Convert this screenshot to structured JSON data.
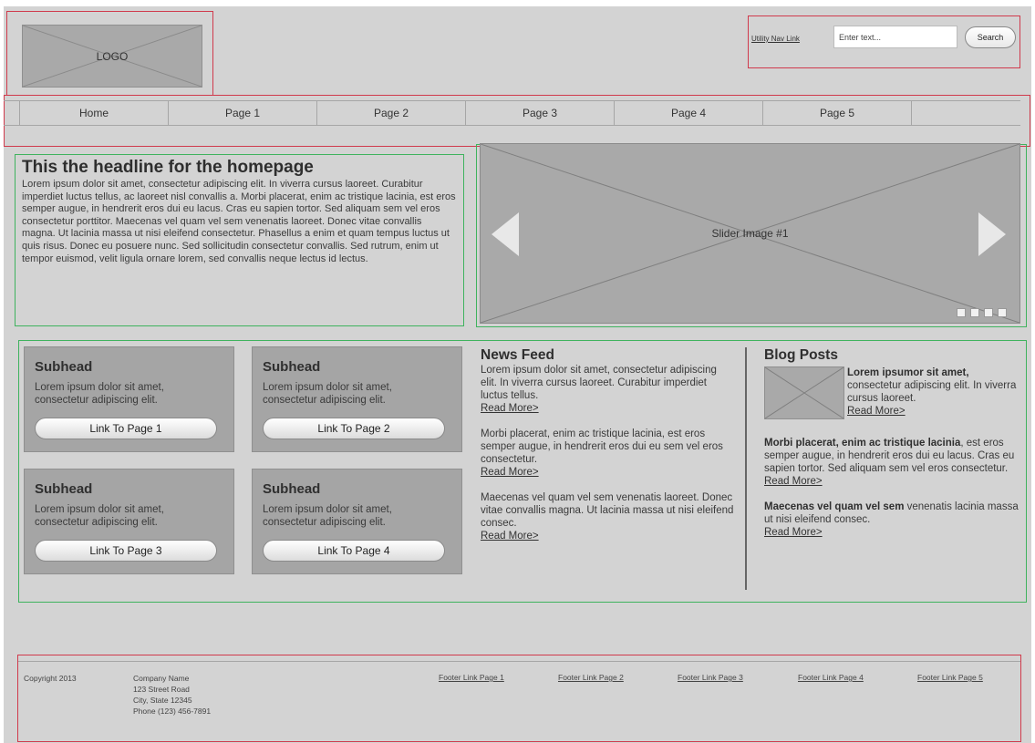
{
  "header": {
    "logo_text": "LOGO",
    "utility_link": "Utility Nav Link",
    "search_placeholder": "Enter text...",
    "search_button": "Search"
  },
  "nav": {
    "items": [
      "Home",
      "Page 1",
      "Page 2",
      "Page 3",
      "Page 4",
      "Page 5"
    ]
  },
  "hero": {
    "headline": "This the headline for the homepage",
    "body": "Lorem ipsum dolor sit amet, consectetur adipiscing elit. In viverra cursus laoreet. Curabitur imperdiet luctus tellus, ac laoreet nisl convallis a. Morbi placerat, enim ac tristique lacinia, est eros semper augue, in hendrerit eros dui eu lacus. Cras eu sapien tortor. Sed aliquam sem vel eros consectetur porttitor. Maecenas vel quam vel sem venenatis laoreet. Donec vitae convallis magna. Ut lacinia massa ut nisi eleifend consectetur. Phasellus a enim et quam tempus luctus ut quis risus. Donec eu posuere nunc. Sed sollicitudin consectetur convallis. Sed rutrum, enim ut tempor euismod, velit ligula ornare lorem, sed convallis neque lectus id lectus.",
    "slider_label": "Slider Image #1",
    "slider_dots": 4
  },
  "cards": [
    {
      "title": "Subhead",
      "text": "Lorem ipsum dolor sit amet, consectetur adipiscing elit.",
      "button": "Link To Page 1"
    },
    {
      "title": "Subhead",
      "text": "Lorem ipsum dolor sit amet, consectetur adipiscing elit.",
      "button": "Link To Page 2"
    },
    {
      "title": "Subhead",
      "text": "Lorem ipsum dolor sit amet, consectetur adipiscing elit.",
      "button": "Link To Page 3"
    },
    {
      "title": "Subhead",
      "text": "Lorem ipsum dolor sit amet, consectetur adipiscing elit.",
      "button": "Link To Page 4"
    }
  ],
  "news": {
    "title": "News Feed",
    "items": [
      {
        "text": "Lorem ipsum dolor sit amet, consectetur adipiscing elit. In viverra cursus laoreet. Curabitur imperdiet luctus tellus.",
        "link": "Read More>"
      },
      {
        "text": "Morbi placerat, enim ac tristique lacinia, est eros semper augue, in hendrerit eros dui eu sem vel eros consectetur.",
        "link": "Read More>"
      },
      {
        "text": "Maecenas vel quam vel sem venenatis laoreet. Donec vitae convallis magna. Ut lacinia massa ut nisi eleifend consec.",
        "link": "Read More>"
      }
    ]
  },
  "blog": {
    "title": "Blog Posts",
    "posts": [
      {
        "bold": "Lorem ipsumor sit amet,",
        "text": " consectetur adipiscing elit. In viverra cursus laoreet.",
        "link": "Read More>"
      },
      {
        "bold": "Morbi placerat, enim ac tristique lacinia",
        "text": ", est eros semper augue, in hendrerit eros dui eu lacus. Cras eu sapien tortor. Sed aliquam sem vel eros consectetur.",
        "link": "Read More>"
      },
      {
        "bold": "Maecenas vel quam vel sem",
        "text": " venenatis lacinia massa ut nisi eleifend consec.",
        "link": "Read More>"
      }
    ]
  },
  "footer": {
    "copyright": "Copyright 2013",
    "company": {
      "name": "Company Name",
      "street": "123 Street Road",
      "city": "City, State 12345",
      "phone": "Phone (123) 456-7891"
    },
    "links": [
      "Footer Link Page 1",
      "Footer Link Page 2",
      "Footer Link Page 3",
      "Footer Link Page 4",
      "Footer Link Page 5"
    ]
  }
}
